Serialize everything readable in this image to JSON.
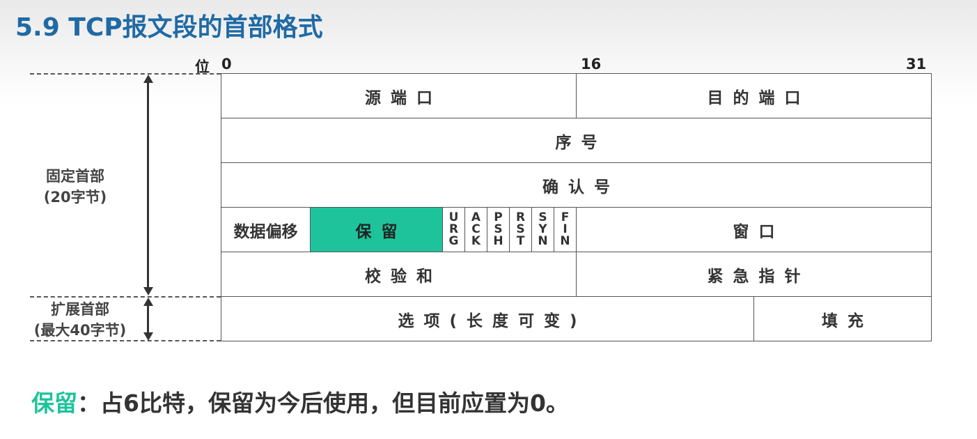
{
  "title": "5.9 TCP报文段的首部格式",
  "bit_labels": {
    "unit": "位",
    "start": "0",
    "mid": "16",
    "end": "31"
  },
  "side_labels": {
    "fixed_line1": "固定首部",
    "fixed_line2": "(20字节)",
    "ext_line1": "扩展首部",
    "ext_line2": "(最大40字节)"
  },
  "fields": {
    "source_port": "源端口",
    "dest_port": "目的端口",
    "seq": "序号",
    "ack_num": "确认号",
    "data_offset": "数据偏移",
    "reserved": "保留",
    "flags": [
      [
        "U",
        "R",
        "G"
      ],
      [
        "A",
        "C",
        "K"
      ],
      [
        "P",
        "S",
        "H"
      ],
      [
        "R",
        "S",
        "T"
      ],
      [
        "S",
        "Y",
        "N"
      ],
      [
        "F",
        "I",
        "N"
      ]
    ],
    "window": "窗口",
    "checksum": "校验和",
    "urgent_pointer": "紧急指针",
    "options": "选项(长度可变)",
    "padding": "填充"
  },
  "note": {
    "highlight": "保留",
    "text": "：占6比特，保留为今后使用，但目前应置为0。"
  },
  "colors": {
    "title": "#1f6aa5",
    "reserved_fill": "#1ec39c"
  }
}
